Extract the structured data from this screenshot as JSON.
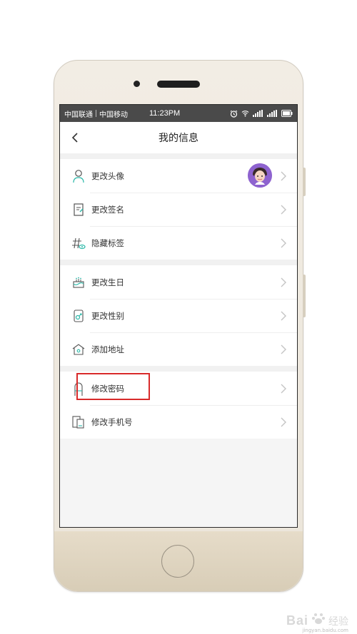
{
  "status_bar": {
    "carrier1": "中国联通",
    "carrier2": "中国移动",
    "time": "11:23PM"
  },
  "header": {
    "title": "我的信息"
  },
  "groups": [
    {
      "items": [
        {
          "label": "更改头像",
          "icon": "person-icon"
        },
        {
          "label": "更改签名",
          "icon": "signature-icon"
        },
        {
          "label": "隐藏标签",
          "icon": "hashtag-eye-icon"
        }
      ]
    },
    {
      "items": [
        {
          "label": "更改生日",
          "icon": "cake-icon"
        },
        {
          "label": "更改性别",
          "icon": "gender-icon"
        },
        {
          "label": "添加地址",
          "icon": "house-icon"
        }
      ]
    },
    {
      "items": [
        {
          "label": "修改密码",
          "icon": "lock-icon"
        },
        {
          "label": "修改手机号",
          "icon": "phone-icon"
        }
      ]
    }
  ],
  "colors": {
    "accent": "#2bb8a8",
    "highlight_box": "#d82a2a",
    "avatar_bg": "#8e63cf",
    "status_bar_bg": "#4a4a4a"
  },
  "watermark": {
    "brand": "Bai",
    "brand2": "经验",
    "url": "jingyan.baidu.com"
  }
}
